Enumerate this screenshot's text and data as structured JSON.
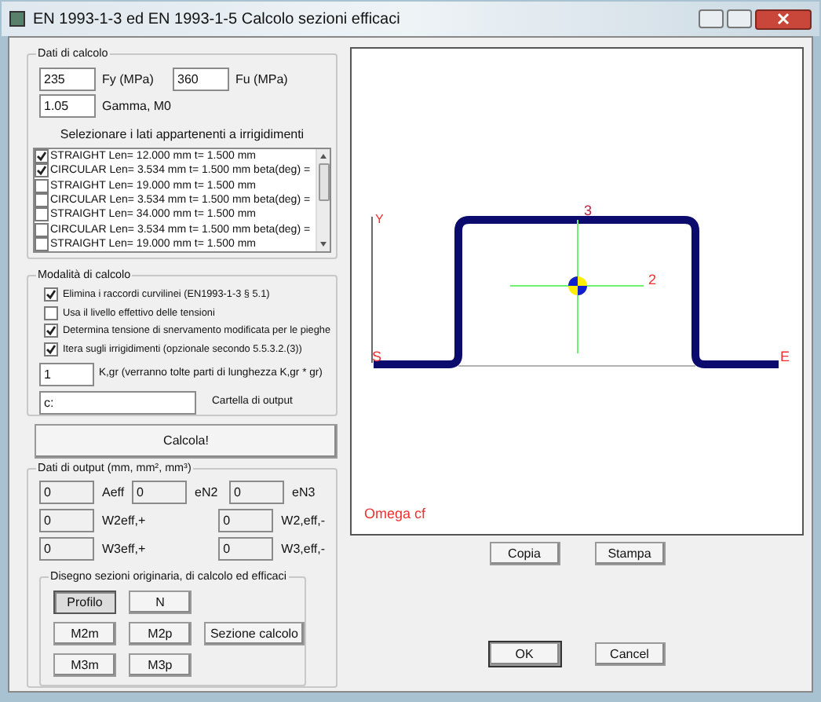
{
  "window": {
    "title": "EN 1993-1-3  ed EN 1993-1-5 Calcolo sezioni efficaci"
  },
  "dati_di_calcolo": {
    "title": "Dati di calcolo",
    "fy": {
      "value": "235",
      "label": "Fy (MPa)"
    },
    "fu": {
      "value": "360",
      "label": "Fu (MPa)"
    },
    "gamma": {
      "value": "1.05",
      "label": "Gamma, M0"
    },
    "list_heading": "Selezionare i lati appartenenti a irrigidimenti",
    "sides": [
      {
        "text": "STRAIGHT Len= 12.000 mm t= 1.500 mm",
        "checked": true
      },
      {
        "text": "CIRCULAR Len= 3.534 mm t= 1.500 mm beta(deg) =",
        "checked": true
      },
      {
        "text": "STRAIGHT Len= 19.000 mm t= 1.500 mm",
        "checked": false
      },
      {
        "text": "CIRCULAR Len= 3.534 mm t= 1.500 mm beta(deg) =",
        "checked": false
      },
      {
        "text": "STRAIGHT Len= 34.000 mm t= 1.500 mm",
        "checked": false
      },
      {
        "text": "CIRCULAR Len= 3.534 mm t= 1.500 mm beta(deg) =",
        "checked": false
      },
      {
        "text": "STRAIGHT Len= 19.000 mm t= 1.500 mm",
        "checked": false
      }
    ]
  },
  "modalita": {
    "title": "Modalità di calcolo",
    "options": [
      {
        "label": "Elimina i raccordi curvilinei (EN1993-1-3  § 5.1)",
        "checked": true
      },
      {
        "label": "Usa il livello effettivo delle tensioni",
        "checked": false
      },
      {
        "label": "Determina tensione di snervamento modificata per le pieghe",
        "checked": true
      },
      {
        "label": "Itera sugli irrigidimenti (opzionale secondo 5.5.3.2.(3))",
        "checked": true
      }
    ],
    "kgr": {
      "value": "1",
      "label": "K,gr (verranno tolte parti di lunghezza K,gr * gr)"
    },
    "cartella": {
      "value": "c:",
      "label": "Cartella di output"
    }
  },
  "calcola_button": "Calcola!",
  "output": {
    "title": "Dati di output (mm, mm², mm³)",
    "rows": [
      {
        "left": {
          "value": "0",
          "label": "Aeff"
        },
        "middle": {
          "value": "0",
          "label": "eN2"
        },
        "right": {
          "value": "0",
          "label": "eN3"
        }
      },
      {
        "left": {
          "value": "0",
          "label": "W2eff,+"
        },
        "right": {
          "value": "0",
          "label": "W2,eff,-"
        }
      },
      {
        "left": {
          "value": "0",
          "label": "W3eff,+"
        },
        "right": {
          "value": "0",
          "label": "W3,eff,-"
        }
      }
    ]
  },
  "disegno": {
    "title": "Disegno sezioni originaria, di calcolo ed efficaci",
    "buttons": [
      {
        "label": "Profilo",
        "selected": true
      },
      {
        "label": "N",
        "selected": false
      },
      {
        "label": "M2m",
        "selected": false
      },
      {
        "label": "M2p",
        "selected": false
      },
      {
        "label": "M3m",
        "selected": false
      },
      {
        "label": "M3p",
        "selected": false
      }
    ],
    "sezione_button": "Sezione calcolo"
  },
  "drawing": {
    "section_name": "Omega cf",
    "axis_y": "Y",
    "start": "S",
    "end": "E",
    "axis_2": "2",
    "axis_3": "3"
  },
  "copia_button": "Copia",
  "stampa_button": "Stampa",
  "ok_button": "OK",
  "cancel_button": "Cancel"
}
